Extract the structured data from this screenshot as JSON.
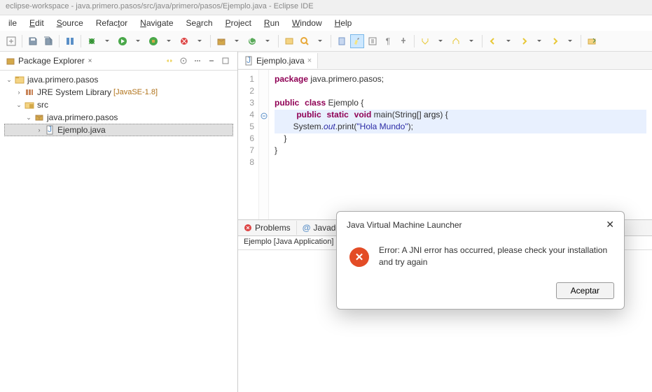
{
  "window": {
    "title": "eclipse-workspace - java.primero.pasos/src/java/primero/pasos/Ejemplo.java - Eclipse IDE"
  },
  "menu": {
    "file": "ile",
    "edit": "Edit",
    "source": "Source",
    "refactor": "Refactor",
    "navigate": "Navigate",
    "search": "Search",
    "project": "Project",
    "run": "Run",
    "window": "Window",
    "help": "Help"
  },
  "sidebar": {
    "title": "Package Explorer",
    "project": "java.primero.pasos",
    "jre_label": "JRE System Library",
    "jre_tag": "[JavaSE-1.8]",
    "src": "src",
    "pkg": "java.primero.pasos",
    "file": "Ejemplo.java"
  },
  "editor": {
    "tab": "Ejemplo.java",
    "lines": {
      "l1": "1",
      "l2": "2",
      "l3": "3",
      "l4": "4",
      "l5": "5",
      "l6": "6",
      "l7": "7",
      "l8": "8"
    },
    "code": {
      "pkg_kw": "package",
      "pkg_name": " java.primero.pasos;",
      "public": "public",
      "class_kw": "class",
      "class_name": " Ejemplo {",
      "static": "static",
      "void": "void",
      "main": " main(String[] ",
      "args": "args",
      "main_end": ") {",
      "sys": "        System.",
      "out": "out",
      "print": ".print(",
      "str": "\"Hola Mundo\"",
      "end": ");",
      "close1": "    }",
      "close2": "}"
    }
  },
  "bottom": {
    "problems": "Problems",
    "javadoc": "Javadoc",
    "console_header": "Ejemplo [Java Application] C"
  },
  "dialog": {
    "title": "Java Virtual Machine Launcher",
    "message": "Error: A JNI error has occurred, please check your installation and try again",
    "ok": "Aceptar"
  }
}
